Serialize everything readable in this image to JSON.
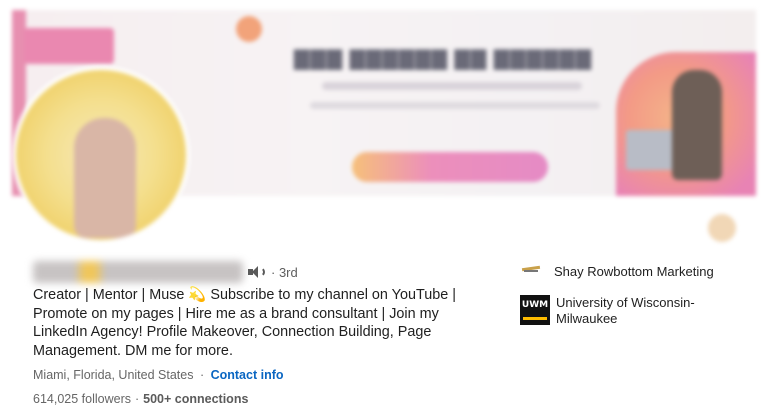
{
  "profile": {
    "degree": "· 3rd",
    "headline": "Creator | Mentor | Muse 💫 Subscribe to my channel on YouTube | Promote on my pages | Hire me as a brand consultant | Join my LinkedIn Agency! Profile Makeover, Connection Building, Page Management. DM me for more.",
    "location": "Miami, Florida, United States",
    "contact_info": "Contact info",
    "followers": "614,025 followers",
    "connections": "500+ connections"
  },
  "organizations": [
    {
      "name": "Shay Rowbottom Marketing",
      "icon": "company-logo-icon"
    },
    {
      "name": "University of Wisconsin-Milwaukee",
      "icon": "uwm-logo-icon",
      "logo_text": "UWM"
    }
  ],
  "colors": {
    "link": "#0a66c2",
    "secondary_text": "#666666",
    "banner_accent": "#ea88b0"
  }
}
